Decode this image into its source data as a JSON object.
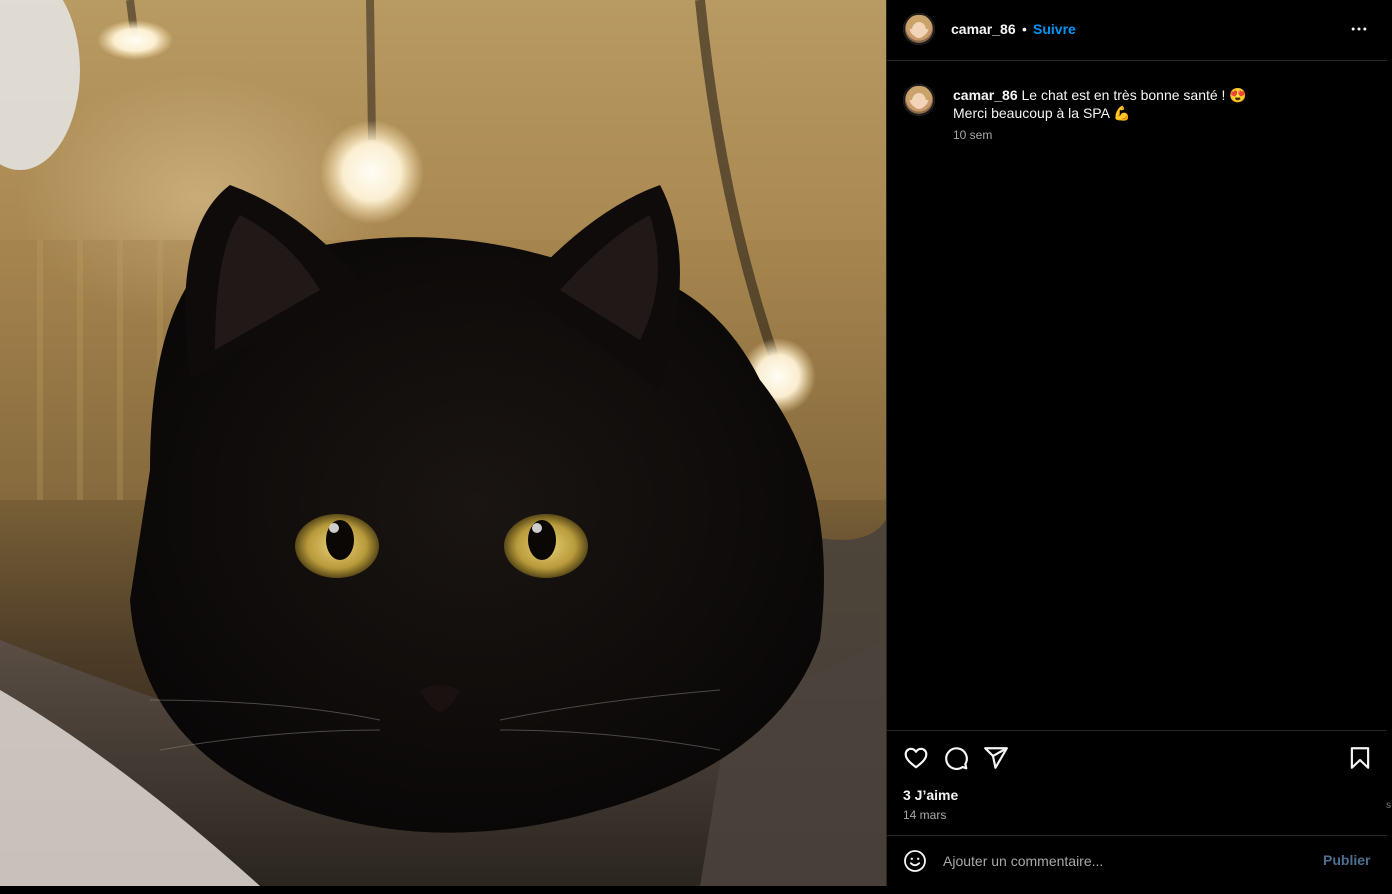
{
  "post": {
    "photo_alt": "black cat",
    "username": "camar_86",
    "separator": "•",
    "follow_label": "Suivre",
    "more_icon": "more-horizontal-icon"
  },
  "caption": {
    "username": "camar_86",
    "line1": "Le chat est en très bonne santé ! 😍",
    "line2": "Merci beaucoup à la SPA 💪",
    "time_ago": "10 sem"
  },
  "actions": {
    "like_icon": "heart-icon",
    "comment_icon": "comment-icon",
    "share_icon": "send-icon",
    "save_icon": "bookmark-icon"
  },
  "stats": {
    "likes": "3 J’aime",
    "date": "14 mars"
  },
  "comment_box": {
    "emoji_icon": "smiley-icon",
    "placeholder": "Ajouter un commentaire...",
    "publish_label": "Publier"
  },
  "edge_fragment": "s",
  "colors": {
    "background": "#000000",
    "text": "#f5f5f5",
    "secondary_text": "#a8a8a8",
    "link_blue": "#0095f6",
    "publish_disabled": "#4f6f8f",
    "divider": "#262626"
  }
}
